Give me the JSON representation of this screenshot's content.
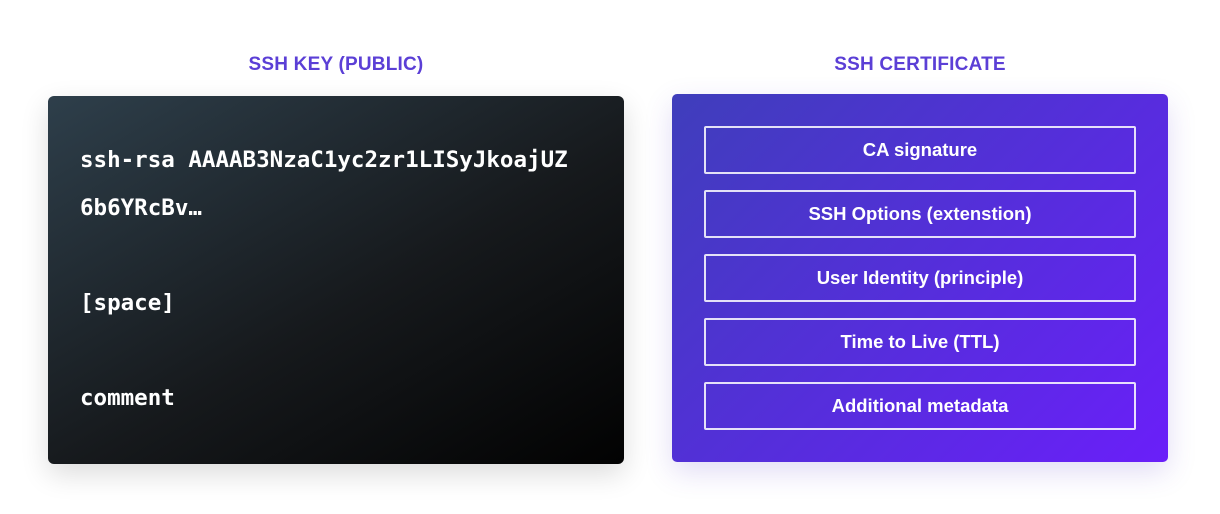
{
  "ssh_key": {
    "heading": "SSH KEY (PUBLIC)",
    "lines": {
      "l0": "ssh-rsa AAAAB3NzaC1yc2zr1LISyJkoajUZ",
      "l1": "6b6YRcBv…",
      "l2": "[space]",
      "l3": "comment"
    }
  },
  "ssh_certificate": {
    "heading": "SSH CERTIFICATE",
    "fields": [
      "CA signature",
      "SSH Options (extenstion)",
      "User Identity (principle)",
      "Time to Live (TTL)",
      "Additional metadata"
    ]
  },
  "colors": {
    "heading_text": "#5b3fd6",
    "key_gradient_start": "#2e3f4b",
    "key_gradient_end": "#020202",
    "cert_gradient_start": "#3f3ebb",
    "cert_gradient_end": "#6a1ff9",
    "field_border": "#ffffff"
  }
}
